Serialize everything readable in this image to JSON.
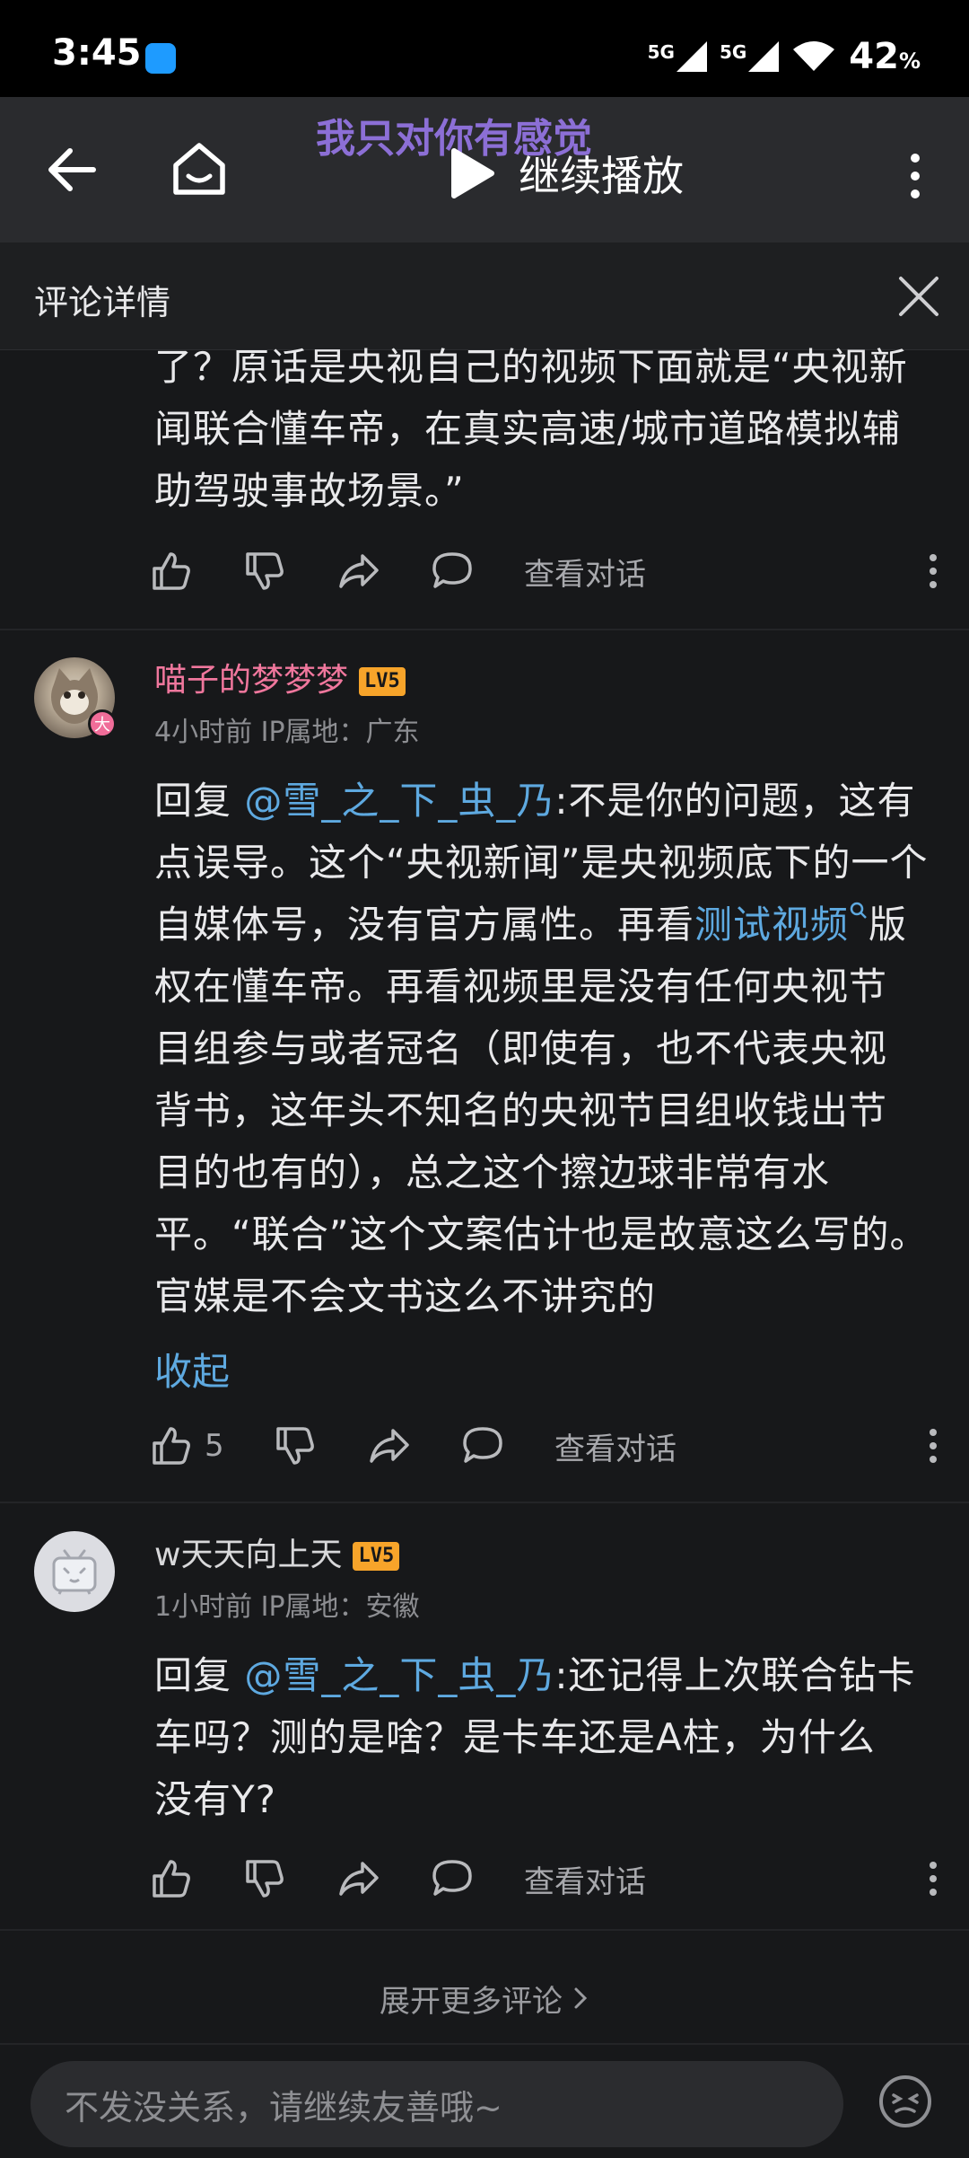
{
  "status_bar": {
    "time": "3:45",
    "signal1": "5G",
    "signal2": "5G",
    "battery": "42",
    "battery_unit": "%"
  },
  "top_bar": {
    "overlay_title": "我只对你有感觉",
    "play_label": "继续播放"
  },
  "detail_header": {
    "title": "评论详情"
  },
  "comments": [
    {
      "text_lines": [
        "了？原话是央视自己的视频下面就是“央视新",
        "闻联合懂车帝，在真实高速/城市道路模拟辅",
        "助驾驶事故场景。”"
      ],
      "view_conversation": "查看对话"
    },
    {
      "username": "喵子的梦梦梦",
      "level": "LV5",
      "avatar_badge": "大",
      "meta": "4小时前 IP属地：广东",
      "reply_prefix": "回复",
      "mention": "@雪_之_下_虫_乃",
      "line1_rest": ":不是你的问题，这有",
      "line2": "点误导。这个“央视新闻”是央视频底下的一个",
      "line3_before": "自媒体号，没有官方属性。再看",
      "line3_link": "测试视频",
      "line3_after": "版",
      "lines_rest": [
        "权在懂车帝。再看视频里是没有任何央视节",
        "目组参与或者冠名（即使有，也不代表央视",
        "背书，这年头不知名的央视节目组收钱出节",
        "目的也有的），总之这个擦边球非常有水",
        "平。“联合”这个文案估计也是故意这么写的。",
        "官媒是不会文书这么不讲究的"
      ],
      "collapse_label": "收起",
      "like_count": "5",
      "view_conversation": "查看对话"
    },
    {
      "username": "w天天向上天",
      "level": "LV5",
      "meta": "1小时前 IP属地：安徽",
      "reply_prefix": "回复",
      "mention": "@雪_之_下_虫_乃",
      "line1_rest": ":还记得上次联合钻卡",
      "lines_rest": [
        "车吗？测的是啥？是卡车还是A柱，为什么",
        "没有Y?"
      ],
      "view_conversation": "查看对话"
    }
  ],
  "expand_more": "展开更多评论",
  "bottom_bar": {
    "input_placeholder": "不发没关系，请继续友善哦~"
  }
}
